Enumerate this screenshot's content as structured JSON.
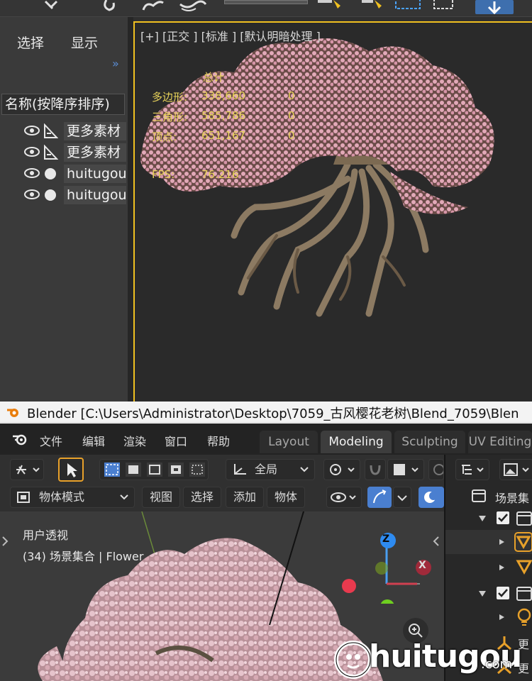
{
  "max": {
    "panel_tabs": [
      "选择",
      "显示"
    ],
    "expand_glyph": "»",
    "outliner_header": "名称(按降序排序)",
    "tree_items": [
      {
        "name": "更多素材",
        "type_icon": "helper-icon"
      },
      {
        "name": "更多素材",
        "type_icon": "helper-icon"
      },
      {
        "name": "huitugou",
        "type_icon": "sphere-icon"
      },
      {
        "name": "huitugou",
        "type_icon": "sphere-icon"
      }
    ],
    "viewport_label": "[+] [正交 ] [标准 ] [默认明暗处理 ]",
    "stats": {
      "header": "总计",
      "rows": [
        {
          "label": "多边形:",
          "value": "338,660",
          "sel": "0"
        },
        {
          "label": "三角形:",
          "value": "585,786",
          "sel": "0"
        },
        {
          "label": "顶点:",
          "value": "651,167",
          "sel": "0"
        }
      ],
      "fps_label": "FPS:",
      "fps_value": "76.216"
    }
  },
  "blender": {
    "window_title": "Blender [C:\\Users\\Administrator\\Desktop\\7059_古风樱花老树\\Blend_7059\\Blen",
    "menu": [
      "文件",
      "编辑",
      "渲染",
      "窗口",
      "帮助"
    ],
    "workspace_tabs": [
      "Layout",
      "Modeling",
      "Sculpting",
      "UV Editing"
    ],
    "active_tab": "Modeling",
    "transform_orientation": "全局",
    "mode": "物体模式",
    "header_menus": [
      "视图",
      "选择",
      "添加",
      "物体"
    ],
    "view_name": "用户透视",
    "collection_info": "(34) 场景集合 | Flower",
    "gizmo": {
      "z": "Z",
      "x": "X"
    },
    "outliner": {
      "title": "场景集",
      "rows": [
        "更",
        "更"
      ]
    }
  },
  "watermark": {
    "brand": "huitugou",
    "suffix": ".com"
  },
  "colors": {
    "accent_yellow": "#f0c020",
    "blossom": "#d9a0b0",
    "blender_blue": "#4a7fd0",
    "stat_yellow": "#e8d35a"
  }
}
